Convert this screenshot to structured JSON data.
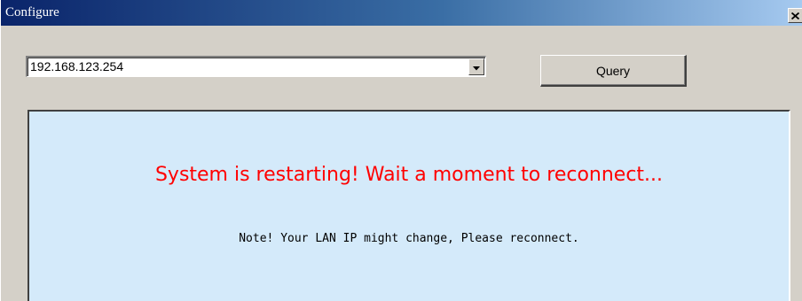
{
  "window": {
    "title": "Configure",
    "close_icon": "close-x-icon"
  },
  "address_select": {
    "selected_value": "192.168.123.254",
    "arrow_icon": "dropdown-arrow-icon"
  },
  "query_button": {
    "label": "Query"
  },
  "message_panel": {
    "main_message": "System is restarting! Wait a moment to reconnect...",
    "note": "Note! Your LAN IP might change, Please reconnect."
  },
  "colors": {
    "titlebar_start": "#0a246a",
    "titlebar_end": "#a6caf0",
    "panel_background": "#d4eafa",
    "main_message": "#ff0000",
    "window_face": "#d4d0c8"
  }
}
